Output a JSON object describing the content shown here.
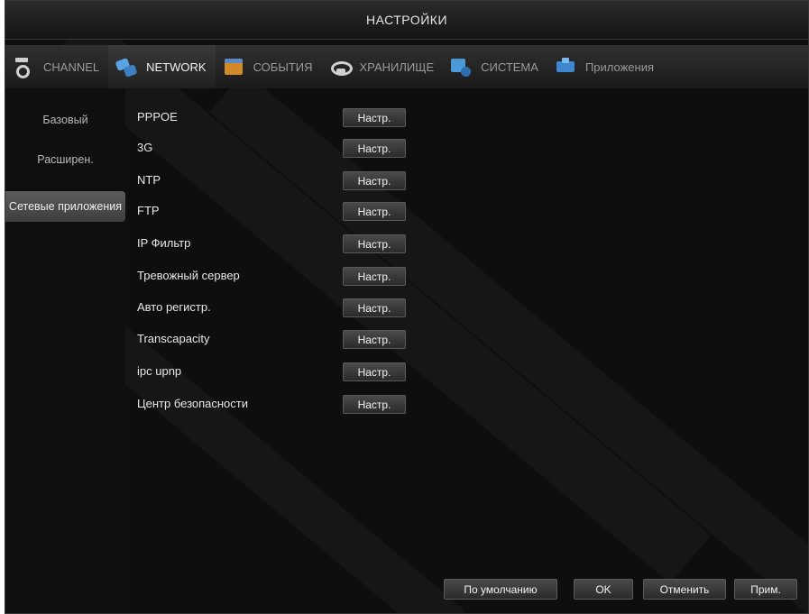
{
  "window": {
    "title": "НАСТРОЙКИ"
  },
  "tabs": [
    {
      "label": "CHANNEL",
      "icon": "camera-icon"
    },
    {
      "label": "NETWORK",
      "icon": "network-icon",
      "active": true
    },
    {
      "label": "СОБЫТИЯ",
      "icon": "events-icon"
    },
    {
      "label": "ХРАНИЛИЩЕ",
      "icon": "storage-icon"
    },
    {
      "label": "СИСТЕМА",
      "icon": "system-icon"
    },
    {
      "label": "Приложения",
      "icon": "apps-icon"
    }
  ],
  "sidebar": {
    "items": [
      {
        "label": "Базовый"
      },
      {
        "label": "Расширен."
      },
      {
        "label": "Сетевые приложения",
        "active": true
      }
    ]
  },
  "settings": {
    "button_label": "Настр.",
    "rows": [
      {
        "label": "PPPOE"
      },
      {
        "label": "3G"
      },
      {
        "label": "NTP"
      },
      {
        "label": "FTP"
      },
      {
        "label": "IP Фильтр"
      },
      {
        "label": "Тревожный сервер"
      },
      {
        "label": "Авто регистр."
      },
      {
        "label": "Transcapacity"
      },
      {
        "label": "ipc upnp"
      },
      {
        "label": "Центр безопасности"
      }
    ]
  },
  "footer": {
    "default_label": "По умолчанию",
    "ok_label": "OK",
    "cancel_label": "Отменить",
    "apply_label": "Прим."
  },
  "colors": {
    "background": "#0e0e0e",
    "text": "#e8e8e8",
    "button_bg": "#3a3a3a"
  }
}
